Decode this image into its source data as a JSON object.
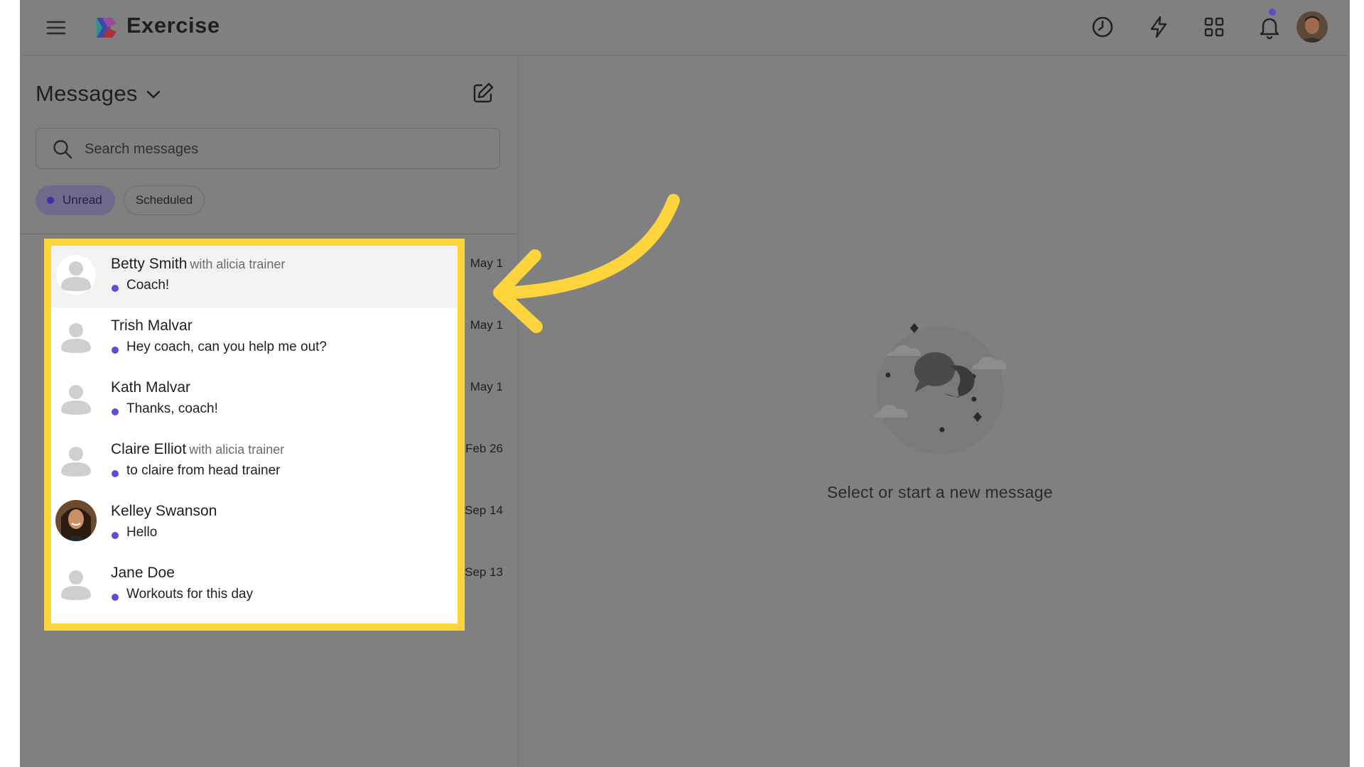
{
  "header": {
    "app_name": "Exercise",
    "icons": [
      "menu-icon",
      "clock-icon",
      "lightning-icon",
      "grid-icon",
      "bell-icon"
    ]
  },
  "sidebar": {
    "title": "Messages",
    "search": {
      "placeholder": "Search messages",
      "value": ""
    },
    "filters": [
      {
        "label": "Unread",
        "active": true
      },
      {
        "label": "Scheduled",
        "active": false
      }
    ],
    "conversations": [
      {
        "name": "Betty Smith",
        "with": "with alicia trainer",
        "preview": "Coach!",
        "date": "May 1",
        "unread": true,
        "selected": true
      },
      {
        "name": "Trish Malvar",
        "with": "",
        "preview": "Hey coach, can you help me out?",
        "date": "May 1",
        "unread": true,
        "selected": false
      },
      {
        "name": "Kath Malvar",
        "with": "",
        "preview": "Thanks, coach!",
        "date": "May 1",
        "unread": true,
        "selected": false
      },
      {
        "name": "Claire Elliot",
        "with": "with alicia trainer",
        "preview": "to claire from head trainer",
        "date": "Feb 26",
        "unread": true,
        "selected": false
      },
      {
        "name": "Kelley Swanson",
        "with": "",
        "preview": "Hello",
        "date": "Sep 14",
        "unread": true,
        "selected": false
      },
      {
        "name": "Jane Doe",
        "with": "",
        "preview": "Workouts for this day",
        "date": "Sep 13",
        "unread": true,
        "selected": false
      }
    ]
  },
  "main": {
    "empty_state": "Select or start a new message"
  },
  "colors": {
    "overlay": "#808080",
    "highlight_border": "#fdd43c",
    "unread_dot": "#5b4fd9",
    "notification_dot": "#5b4bd1"
  }
}
